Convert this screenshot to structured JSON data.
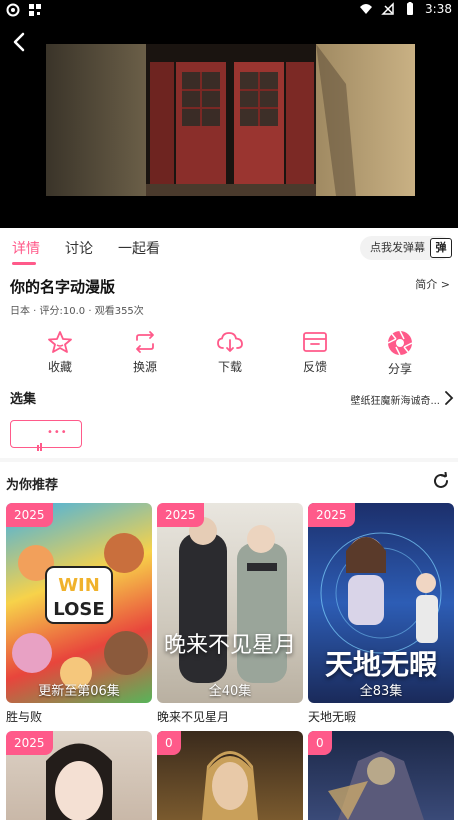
{
  "status_bar": {
    "time": "3:38",
    "icons": [
      "sync-icon",
      "grid-icon",
      "wifi-icon",
      "no-signal-icon",
      "battery-icon"
    ]
  },
  "player": {
    "back_icon": "back-arrow-icon"
  },
  "tabs": [
    {
      "label": "详情",
      "active": true
    },
    {
      "label": "讨论",
      "active": false
    },
    {
      "label": "一起看",
      "active": false
    }
  ],
  "danmu": {
    "placeholder": "点我发弹幕",
    "icon_label": "弹"
  },
  "video": {
    "title": "你的名字动漫版",
    "intro_label": "简介 >",
    "meta": "日本 · 评分:10.0 · 观看355次"
  },
  "actions": [
    {
      "label": "收藏",
      "icon": "star-icon"
    },
    {
      "label": "换源",
      "icon": "switch-source-icon"
    },
    {
      "label": "下载",
      "icon": "cloud-download-icon"
    },
    {
      "label": "反馈",
      "icon": "feedback-icon"
    },
    {
      "label": "分享",
      "icon": "share-icon"
    }
  ],
  "episodes": {
    "section_title": "选集",
    "source_label": "壁纸狂魔新海诚奇...",
    "current_episode_dots": "•••"
  },
  "recommend": {
    "title": "为你推荐",
    "items": [
      {
        "badge": "2025",
        "episodes": "更新至第06集",
        "name": "胜与败",
        "poster_text": "WIN LOSE"
      },
      {
        "badge": "2025",
        "episodes": "全40集",
        "name": "晚来不见星月",
        "poster_text": "晚来不见星月"
      },
      {
        "badge": "2025",
        "episodes": "全83集",
        "name": "天地无暇",
        "poster_text": "天地无暇"
      },
      {
        "badge": "2025",
        "episodes": "",
        "name": "",
        "poster_text": ""
      },
      {
        "badge": "0",
        "episodes": "",
        "name": "",
        "poster_text": ""
      },
      {
        "badge": "0",
        "episodes": "",
        "name": "",
        "poster_text": ""
      }
    ]
  },
  "colors": {
    "accent": "#ff5a8a",
    "text": "#222222"
  }
}
